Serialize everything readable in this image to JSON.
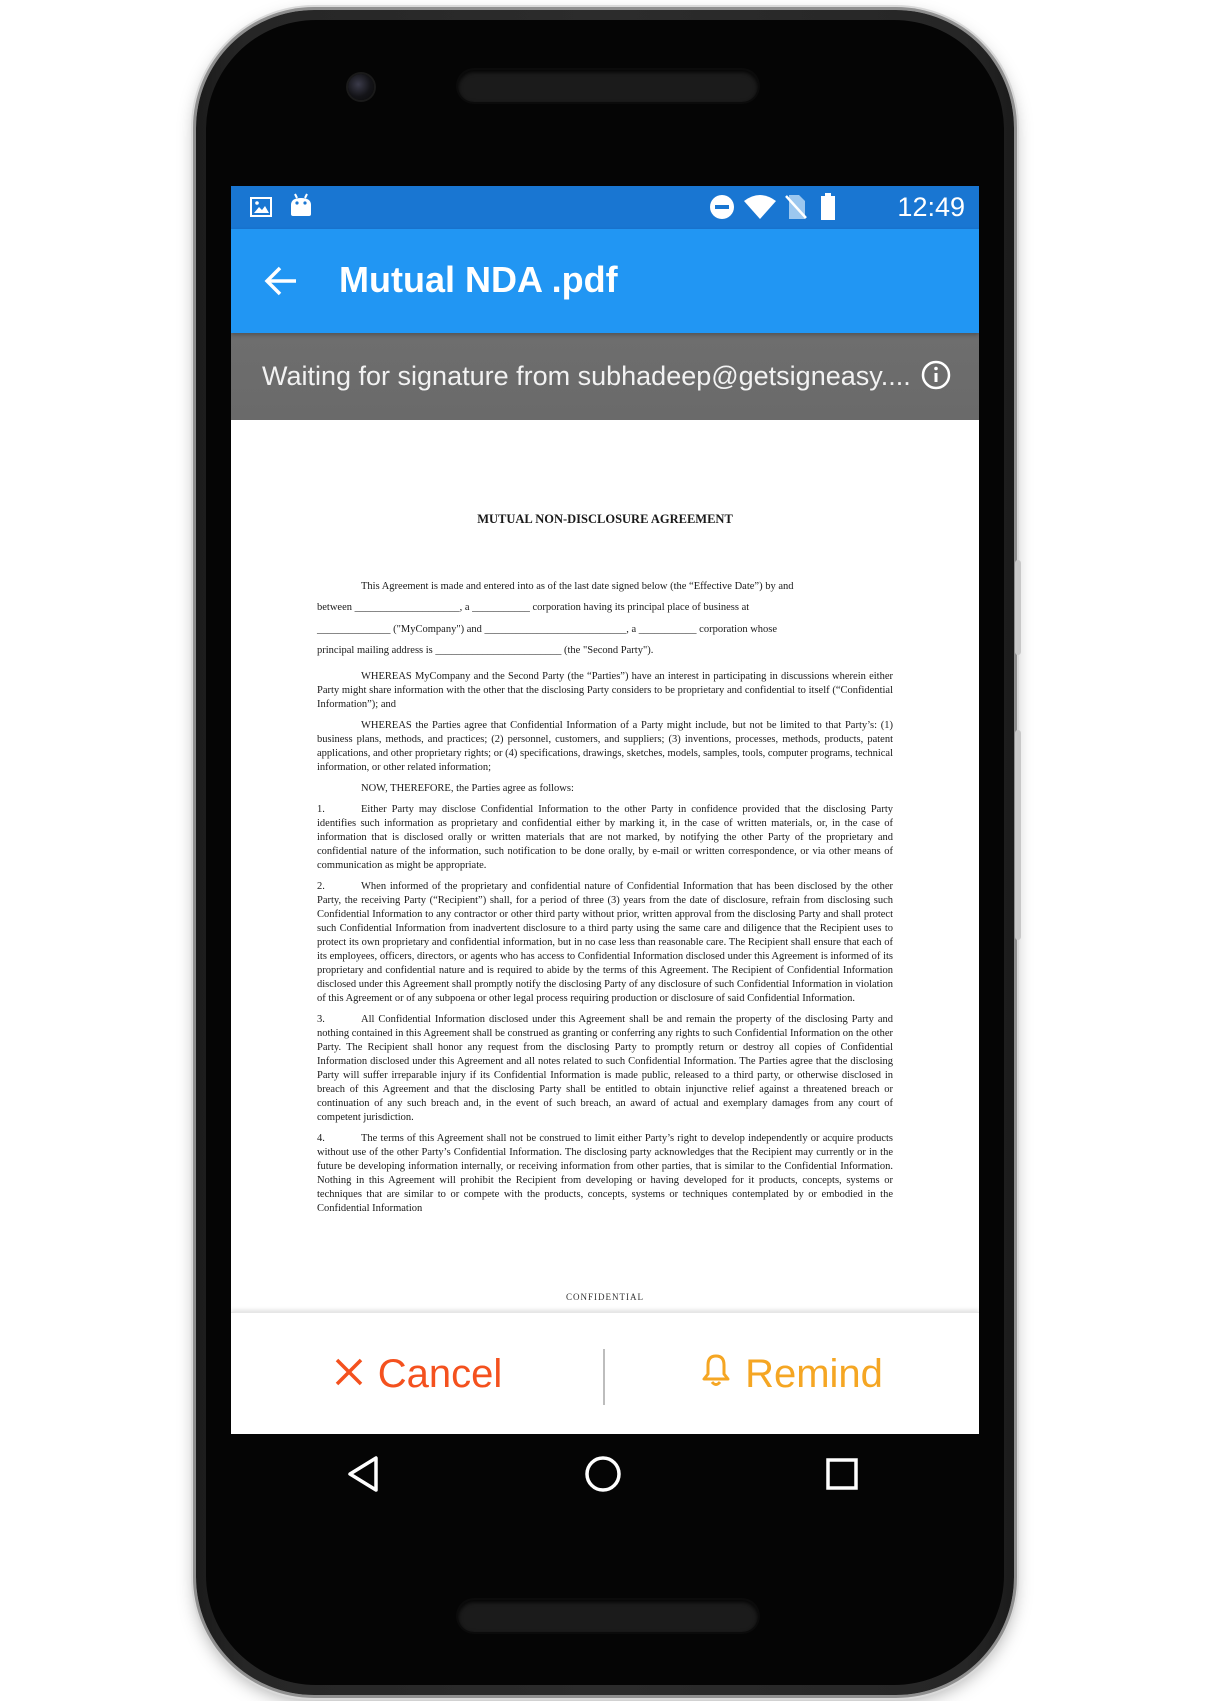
{
  "status_bar": {
    "time": "12:49",
    "left_icons": [
      "image-icon",
      "android-icon"
    ],
    "right_icons": [
      "do-not-disturb-icon",
      "wifi-icon",
      "no-sim-icon",
      "battery-icon"
    ]
  },
  "app_bar": {
    "title": "Mutual NDA .pdf",
    "back_icon": "arrow-back-icon"
  },
  "banner": {
    "text": "Waiting for signature from subhadeep@getsigneasy....",
    "icon": "info-icon"
  },
  "document": {
    "title": "MUTUAL NON-DISCLOSURE AGREEMENT",
    "intro_lines": [
      "This Agreement is made and entered into as of the last date signed below (the “Effective Date”) by and",
      "between ____________________, a ___________ corporation having its principal place of business at",
      "______________ (\"MyCompany\") and ___________________________, a ___________ corporation whose",
      "principal mailing address is ________________________ (the \"Second Party\")."
    ],
    "paragraphs": [
      {
        "num": "",
        "text": "WHEREAS MyCompany and the Second Party (the “Parties”) have an interest in participating in discussions wherein either Party might share information with the other that the disclosing Party considers to be proprietary and confidential to itself (“Confidential Information”); and"
      },
      {
        "num": "",
        "text": "WHEREAS the Parties agree that Confidential Information of a Party might include, but not be limited to that Party’s: (1) business plans, methods, and practices; (2) personnel, customers, and suppliers; (3) inventions, processes, methods, products, patent applications, and other proprietary rights; or (4) specifications, drawings, sketches, models, samples, tools, computer programs, technical information, or other related information;"
      },
      {
        "num": "",
        "text": "NOW, THEREFORE, the Parties agree as follows:"
      },
      {
        "num": "1.",
        "text": "Either Party may disclose Confidential Information to the other Party in confidence provided that the disclosing Party identifies such information as proprietary and confidential either by marking it, in the case of written materials, or, in the case of information that is disclosed orally or written materials that are not marked, by notifying the other Party of the proprietary and confidential nature of the information, such notification to be done orally, by e-mail or written correspondence, or via other means of communication as might be appropriate."
      },
      {
        "num": "2.",
        "text": "When informed of the proprietary and confidential nature of Confidential Information that has been disclosed by the other Party, the receiving Party (“Recipient”) shall, for a period of three (3) years from the date of disclosure, refrain from disclosing such Confidential Information to any contractor or other third party without prior, written approval from the disclosing Party and shall protect such Confidential Information from inadvertent disclosure to a third party using the same care and diligence that the Recipient uses to protect its own proprietary and confidential information, but in no case less than reasonable care.  The Recipient shall ensure that each of its employees, officers, directors, or agents who has access to Confidential Information disclosed under this Agreement is informed of its proprietary and confidential nature and is required to abide by the terms of this Agreement.  The Recipient of Confidential Information disclosed under this Agreement shall promptly notify the disclosing Party of any disclosure of such Confidential Information in violation of this Agreement or of any subpoena or other legal process requiring production or disclosure of said Confidential Information."
      },
      {
        "num": "3.",
        "text": "All Confidential Information disclosed under this Agreement shall be and remain the property of the disclosing Party and nothing contained in this Agreement shall be construed as granting or conferring any rights to such Confidential Information on the other Party.  The Recipient shall honor any request from the disclosing Party to promptly return or destroy all copies of Confidential Information disclosed under this Agreement and all notes related to such Confidential Information.  The Parties agree that the disclosing Party will suffer irreparable injury if its Confidential Information is made public, released to a third party, or otherwise disclosed in breach of this Agreement and that the disclosing Party shall be entitled to obtain injunctive relief against a threatened breach or continuation of any such breach and, in the event of such breach, an award of actual and exemplary damages from any court of competent jurisdiction."
      },
      {
        "num": "4.",
        "text": "The terms of this Agreement shall not be construed to limit either Party’s right to develop independently or acquire products without use of the other Party’s Confidential Information. The disclosing party acknowledges that the Recipient may currently or in the future be developing information internally, or receiving information from other parties, that is similar to the Confidential Information. Nothing in this Agreement will prohibit the Recipient from developing or having developed for it products, concepts, systems or techniques that are similar to or compete with the products, concepts, systems or techniques contemplated by or embodied in the Confidential Information"
      }
    ],
    "footer_partial": "CONFIDENTIAL"
  },
  "actions": {
    "cancel_label": "Cancel",
    "remind_label": "Remind",
    "cancel_icon": "close-icon",
    "remind_icon": "bell-icon",
    "cancel_color": "#f4511e",
    "remind_color": "#f5a623"
  },
  "colors": {
    "status_bar": "#1976d2",
    "app_bar": "#2196f3",
    "banner": "#6e6e6e"
  },
  "nav": {
    "icons": [
      "back-triangle-icon",
      "home-circle-icon",
      "recents-square-icon"
    ]
  }
}
